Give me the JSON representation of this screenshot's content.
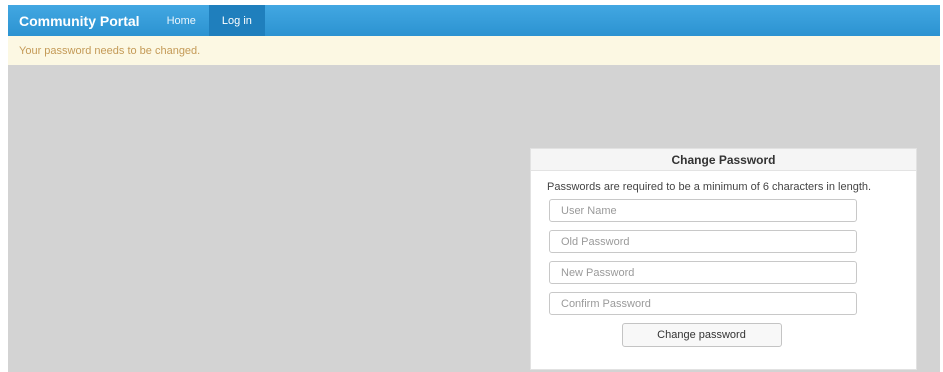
{
  "navbar": {
    "brand": "Community Portal",
    "links": [
      {
        "label": "Home",
        "active": false
      },
      {
        "label": "Log in",
        "active": true
      }
    ]
  },
  "alert": {
    "message": "Your password needs to be changed."
  },
  "change_password": {
    "title": "Change Password",
    "help_text": "Passwords are required to be a minimum of 6 characters in length.",
    "fields": {
      "username": {
        "placeholder": "User Name",
        "value": ""
      },
      "old_password": {
        "placeholder": "Old Password",
        "value": ""
      },
      "new_password": {
        "placeholder": "New Password",
        "value": ""
      },
      "confirm_password": {
        "placeholder": "Confirm Password",
        "value": ""
      }
    },
    "submit_label": "Change password"
  },
  "colors": {
    "navbar": "#2c93d1",
    "nav_active": "#1f7fbd",
    "alert_bg": "#fcf8e3",
    "alert_text": "#c49a57",
    "page_bg": "#d3d3d3"
  }
}
